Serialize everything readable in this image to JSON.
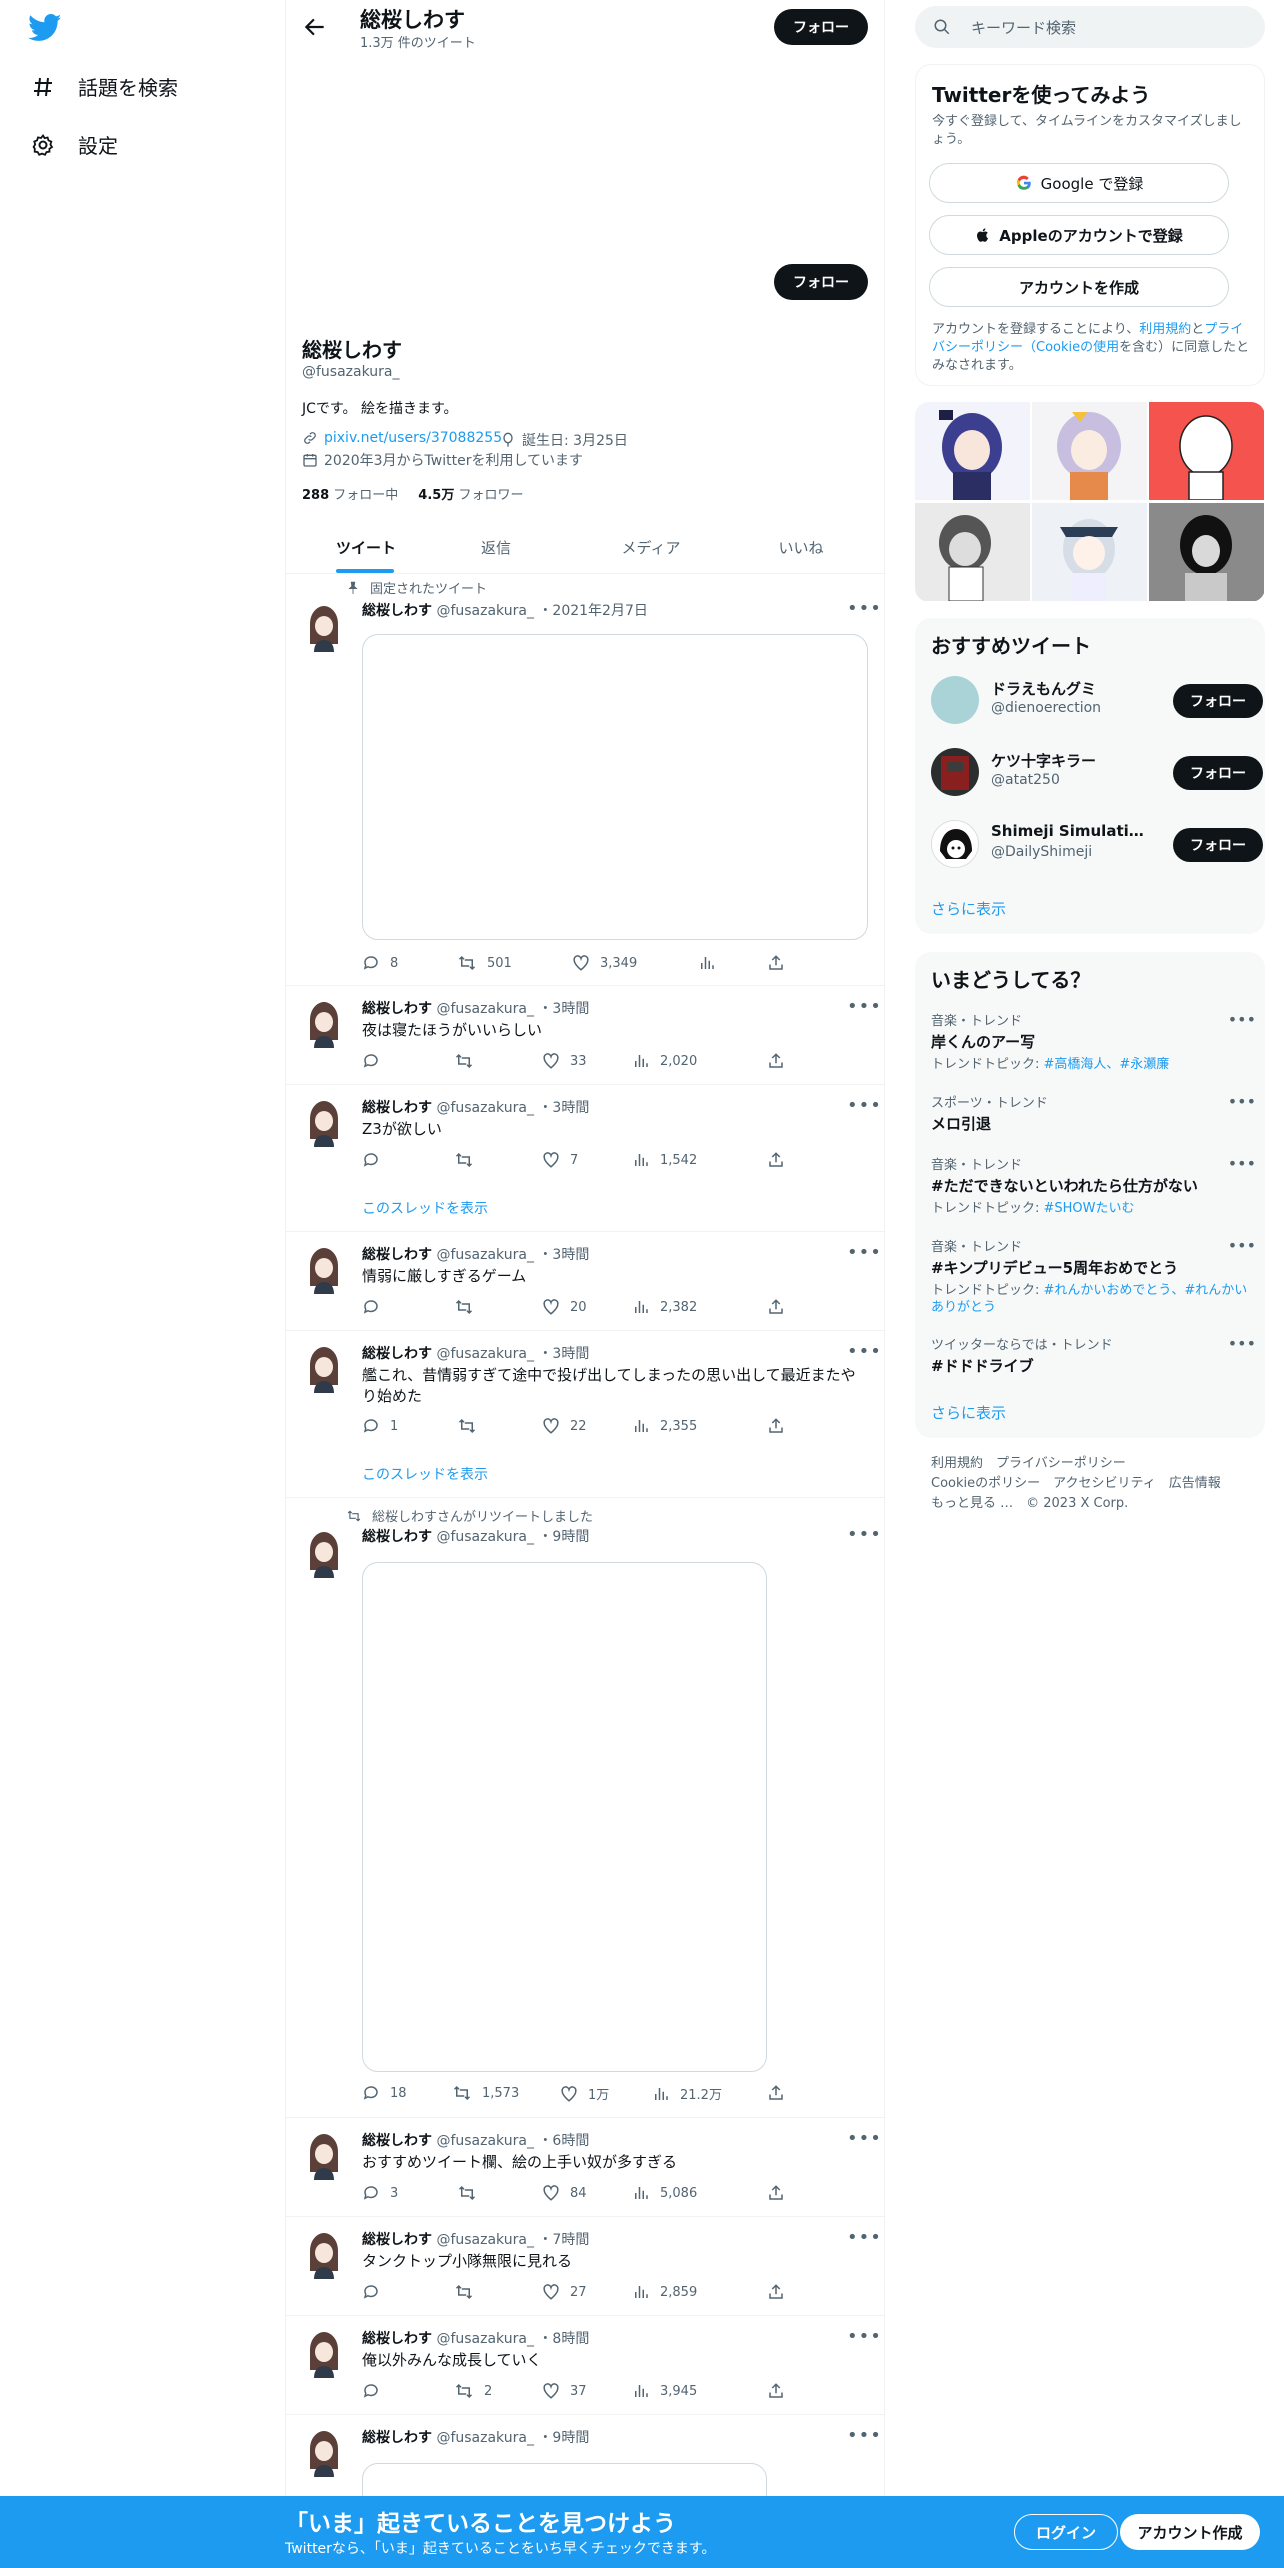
{
  "nav": {
    "explore": "話題を検索",
    "settings": "設定"
  },
  "profile": {
    "name": "総桜しわす",
    "tweet_count": "1.3万 件のツイート",
    "follow_label": "フォロー",
    "handle": "@fusazakura_",
    "bio": "JCです。 絵を描きます。",
    "link": "pixiv.net/users/37088255",
    "birthday": "誕生日: 3月25日",
    "joined": "2020年3月からTwitterを利用しています",
    "following_count": "288",
    "following_label": "フォロー中",
    "followers_count": "4.5万",
    "followers_label": "フォロワー"
  },
  "tabs": [
    "ツイート",
    "返信",
    "メディア",
    "いいね"
  ],
  "pinned_label": "固定されたツイート",
  "retweet_label": "総桜しわすさんがリツイートしました",
  "thread_link": "このスレッドを表示",
  "tweets": [
    {
      "name": "総桜しわす",
      "handle": "@fusazakura_",
      "time": "・2021年2月7日",
      "text": "",
      "reply": "8",
      "retweet": "501",
      "like": "3,349",
      "views": ""
    },
    {
      "name": "総桜しわす",
      "handle": "@fusazakura_",
      "time": "・3時間",
      "text": "夜は寝たほうがいいらしい",
      "reply": "",
      "retweet": "",
      "like": "33",
      "views": "2,020"
    },
    {
      "name": "総桜しわす",
      "handle": "@fusazakura_",
      "time": "・3時間",
      "text": "Z3が欲しい",
      "reply": "",
      "retweet": "",
      "like": "7",
      "views": "1,542"
    },
    {
      "name": "総桜しわす",
      "handle": "@fusazakura_",
      "time": "・3時間",
      "text": "情弱に厳しすぎるゲーム",
      "reply": "",
      "retweet": "",
      "like": "20",
      "views": "2,382"
    },
    {
      "name": "総桜しわす",
      "handle": "@fusazakura_",
      "time": "・3時間",
      "text": "艦これ、昔情弱すぎて途中で投げ出してしまったの思い出して最近またやり始めた",
      "reply": "1",
      "retweet": "",
      "like": "22",
      "views": "2,355"
    },
    {
      "name": "総桜しわす",
      "handle": "@fusazakura_",
      "time": "・9時間",
      "text": "",
      "reply": "18",
      "retweet": "1,573",
      "like": "1万",
      "views": "21.2万"
    },
    {
      "name": "総桜しわす",
      "handle": "@fusazakura_",
      "time": "・6時間",
      "text": "おすすめツイート欄、絵の上手い奴が多すぎる",
      "reply": "3",
      "retweet": "",
      "like": "84",
      "views": "5,086"
    },
    {
      "name": "総桜しわす",
      "handle": "@fusazakura_",
      "time": "・7時間",
      "text": "タンクトップ小隊無限に見れる",
      "reply": "",
      "retweet": "",
      "like": "27",
      "views": "2,859"
    },
    {
      "name": "総桜しわす",
      "handle": "@fusazakura_",
      "time": "・8時間",
      "text": "俺以外みんな成長していく",
      "reply": "",
      "retweet": "2",
      "like": "37",
      "views": "3,945"
    },
    {
      "name": "総桜しわす",
      "handle": "@fusazakura_",
      "time": "・9時間",
      "text": ""
    }
  ],
  "search": {
    "placeholder": "キーワード検索"
  },
  "signup": {
    "title": "Twitterを使ってみよう",
    "subtitle": "今すぐ登録して、タイムラインをカスタマイズしましょう。",
    "google": "Google で登録",
    "apple": "Appleのアカウントで登録",
    "create": "アカウントを作成",
    "terms_pre": "アカウントを登録することにより、",
    "terms_link": "利用規約",
    "terms_mid": "と",
    "privacy_link": "プライバシーポリシー",
    "cookie_link": "（Cookieの使用",
    "terms_post": "を含む）に同意したとみなされます。"
  },
  "recommended": {
    "title": "おすすめツイート",
    "users": [
      {
        "name": "ドラえもんグミ",
        "handle": "@dienoerection",
        "follow": "フォロー"
      },
      {
        "name": "ケツ十字キラー",
        "handle": "@atat250",
        "follow": "フォロー"
      },
      {
        "name": "Shimeji Simulation ga...",
        "handle": "@DailyShimeji",
        "follow": "フォロー"
      }
    ],
    "more": "さらに表示"
  },
  "trends": {
    "title": "いまどうしてる？",
    "items": [
      {
        "category": "音楽・トレンド",
        "name": "岸くんのアー写",
        "sub_label": "トレンドトピック: ",
        "sub_topics": "#高橋海人、#永瀬廉"
      },
      {
        "category": "スポーツ・トレンド",
        "name": "メロ引退",
        "sub_label": "",
        "sub_topics": ""
      },
      {
        "category": "音楽・トレンド",
        "name": "#ただできないといわれたら仕方がない",
        "sub_label": "トレンドトピック: ",
        "sub_topics": "#SHOWたいむ"
      },
      {
        "category": "音楽・トレンド",
        "name": "#キンプリデビュー5周年おめでとう",
        "sub_label": "トレンドトピック: ",
        "sub_topics": "#れんかいおめでとう、#れんかいありがとう"
      },
      {
        "category": "ツイッターならでは・トレンド",
        "name": "#ドドドライブ",
        "sub_label": "",
        "sub_topics": ""
      }
    ],
    "more": "さらに表示"
  },
  "footer": {
    "line1": "利用規約　プライバシーポリシー",
    "line2": "Cookieのポリシー　アクセシビリティ　広告情報",
    "line3": "もっと見る …　© 2023 X Corp."
  },
  "bottom_bar": {
    "title": "「いま」起きていることを見つけよう",
    "subtitle": "Twitterなら、「いま」起きていることをいち早くチェックできます。",
    "login": "ログイン",
    "signup": "アカウント作成"
  },
  "colors": {
    "accent": "#1d9bf0",
    "dark": "#0f1419",
    "muted": "#536471",
    "panel": "#f7f9f9"
  }
}
